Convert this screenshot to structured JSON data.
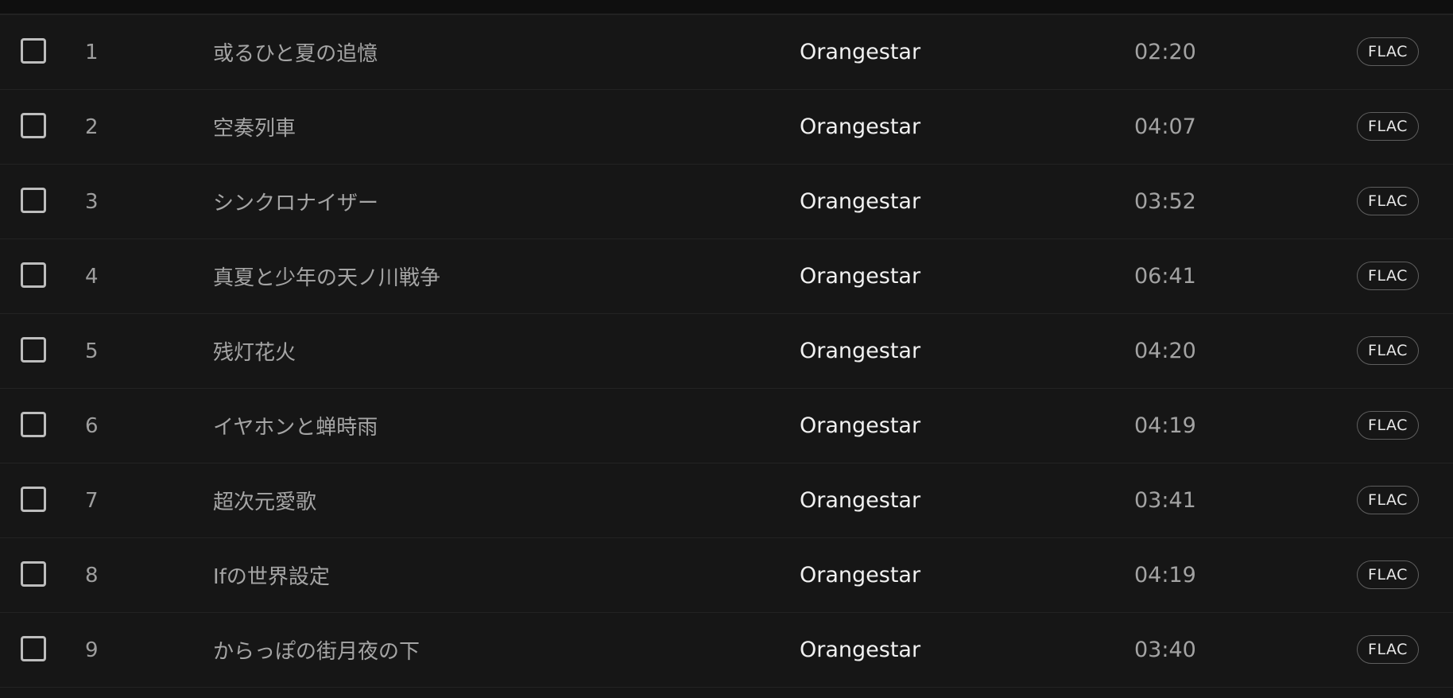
{
  "tracks": [
    {
      "number": "1",
      "title": "或るひと夏の追憶",
      "artist": "Orangestar",
      "duration": "02:20",
      "format": "FLAC",
      "selected": false
    },
    {
      "number": "2",
      "title": "空奏列車",
      "artist": "Orangestar",
      "duration": "04:07",
      "format": "FLAC",
      "selected": false
    },
    {
      "number": "3",
      "title": "シンクロナイザー",
      "artist": "Orangestar",
      "duration": "03:52",
      "format": "FLAC",
      "selected": false
    },
    {
      "number": "4",
      "title": "真夏と少年の天ノ川戦争",
      "artist": "Orangestar",
      "duration": "06:41",
      "format": "FLAC",
      "selected": false
    },
    {
      "number": "5",
      "title": "残灯花火",
      "artist": "Orangestar",
      "duration": "04:20",
      "format": "FLAC",
      "selected": false
    },
    {
      "number": "6",
      "title": "イヤホンと蝉時雨",
      "artist": "Orangestar",
      "duration": "04:19",
      "format": "FLAC",
      "selected": false
    },
    {
      "number": "7",
      "title": "超次元愛歌",
      "artist": "Orangestar",
      "duration": "03:41",
      "format": "FLAC",
      "selected": false
    },
    {
      "number": "8",
      "title": "Ifの世界設定",
      "artist": "Orangestar",
      "duration": "04:19",
      "format": "FLAC",
      "selected": false
    },
    {
      "number": "9",
      "title": "からっぽの街月夜の下",
      "artist": "Orangestar",
      "duration": "03:40",
      "format": "FLAC",
      "selected": false
    }
  ]
}
